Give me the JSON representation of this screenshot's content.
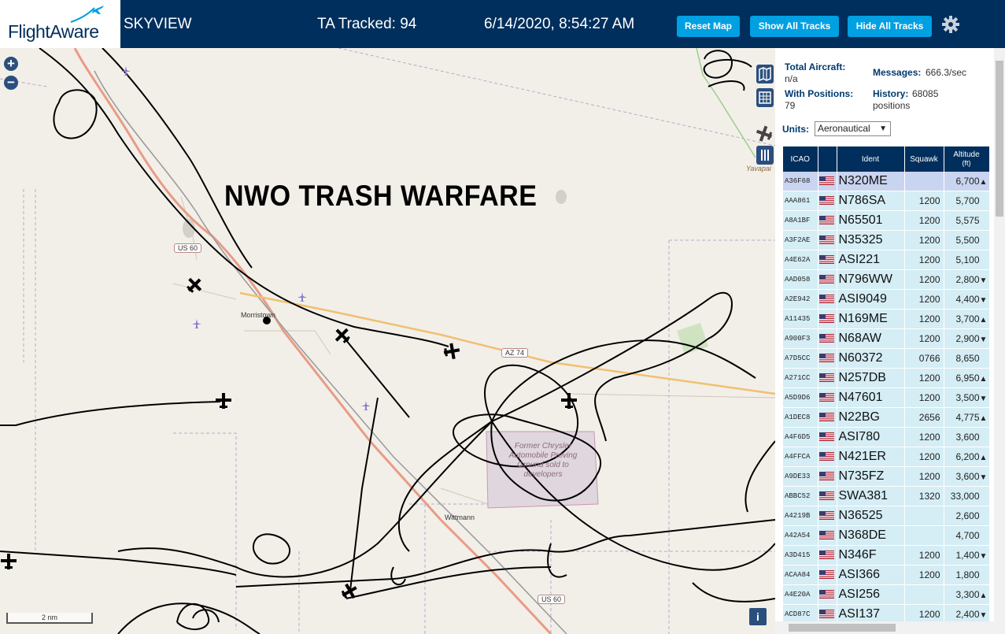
{
  "header": {
    "logo_text": "FlightAware",
    "title": "SKYVIEW",
    "tracked": "TA Tracked: 94",
    "timestamp": "6/14/2020, 8:54:27 AM",
    "buttons": {
      "reset": "Reset Map",
      "show_all": "Show All Tracks",
      "hide_all": "Hide All Tracks"
    },
    "icons": {
      "settings": "gear-icon",
      "logo": "airplane-icon"
    },
    "colors": {
      "header_bg": "#002f5d",
      "button_bg": "#00a0e2"
    }
  },
  "map": {
    "watermark": "NWO TRASH WARFARE",
    "zoom_in": "+",
    "zoom_out": "−",
    "labels": {
      "town1": "Morristown",
      "town2": "Wittmann",
      "proving_ground": "Former Chrysler Automobile Proving Ground sold to developers",
      "region": "Yavapai"
    },
    "shields": {
      "us60_top": "US 60",
      "az74": "AZ 74",
      "us60_bottom": "US 60"
    },
    "scale": "2 nm",
    "info_button": "i",
    "controls": [
      "map-icon",
      "grid-icon",
      "columns-icon"
    ]
  },
  "sidebar": {
    "stats": {
      "total_label": "Total Aircraft:",
      "total_value": "n/a",
      "positions_label": "With Positions:",
      "positions_value": "79",
      "messages_label": "Messages:",
      "messages_value": "666.3/sec",
      "history_label": "History:",
      "history_value": "68085",
      "history_unit": "positions"
    },
    "units_label": "Units:",
    "units_value": "Aeronautical",
    "table": {
      "headers": {
        "icao": "ICAO",
        "flag": "",
        "ident": "Ident",
        "squawk": "Squawk",
        "altitude": "Altitude",
        "altitude_unit": "(ft)"
      },
      "rows": [
        {
          "icao": "A36F68",
          "ident": "N320ME",
          "squawk": "",
          "alt": "6,700",
          "trend": "▲",
          "selected": true
        },
        {
          "icao": "AAA861",
          "ident": "N786SA",
          "squawk": "1200",
          "alt": "5,700",
          "trend": ""
        },
        {
          "icao": "A8A1BF",
          "ident": "N65501",
          "squawk": "1200",
          "alt": "5,575",
          "trend": ""
        },
        {
          "icao": "A3F2AE",
          "ident": "N35325",
          "squawk": "1200",
          "alt": "5,500",
          "trend": ""
        },
        {
          "icao": "A4E62A",
          "ident": "ASI221",
          "squawk": "1200",
          "alt": "5,100",
          "trend": ""
        },
        {
          "icao": "AAD058",
          "ident": "N796WW",
          "squawk": "1200",
          "alt": "2,800",
          "trend": "▼"
        },
        {
          "icao": "A2E942",
          "ident": "ASI9049",
          "squawk": "1200",
          "alt": "4,400",
          "trend": "▼"
        },
        {
          "icao": "A11435",
          "ident": "N169ME",
          "squawk": "1200",
          "alt": "3,700",
          "trend": "▲"
        },
        {
          "icao": "A900F3",
          "ident": "N68AW",
          "squawk": "1200",
          "alt": "2,900",
          "trend": "▼"
        },
        {
          "icao": "A7D5CC",
          "ident": "N60372",
          "squawk": "0766",
          "alt": "8,650",
          "trend": ""
        },
        {
          "icao": "A271CC",
          "ident": "N257DB",
          "squawk": "1200",
          "alt": "6,950",
          "trend": "▲"
        },
        {
          "icao": "A5D9D6",
          "ident": "N47601",
          "squawk": "1200",
          "alt": "3,500",
          "trend": "▼"
        },
        {
          "icao": "A1DEC8",
          "ident": "N22BG",
          "squawk": "2656",
          "alt": "4,775",
          "trend": "▲"
        },
        {
          "icao": "A4F6D5",
          "ident": "ASI780",
          "squawk": "1200",
          "alt": "3,600",
          "trend": ""
        },
        {
          "icao": "A4FFCA",
          "ident": "N421ER",
          "squawk": "1200",
          "alt": "6,200",
          "trend": "▲"
        },
        {
          "icao": "A9DE33",
          "ident": "N735FZ",
          "squawk": "1200",
          "alt": "3,600",
          "trend": "▼"
        },
        {
          "icao": "ABBC52",
          "ident": "SWA381",
          "squawk": "1320",
          "alt": "33,000",
          "trend": ""
        },
        {
          "icao": "A4219B",
          "ident": "N36525",
          "squawk": "",
          "alt": "2,600",
          "trend": ""
        },
        {
          "icao": "A42A54",
          "ident": "N368DE",
          "squawk": "",
          "alt": "4,700",
          "trend": ""
        },
        {
          "icao": "A3D415",
          "ident": "N346F",
          "squawk": "1200",
          "alt": "1,400",
          "trend": "▼"
        },
        {
          "icao": "ACAA84",
          "ident": "ASI366",
          "squawk": "1200",
          "alt": "1,800",
          "trend": ""
        },
        {
          "icao": "A4E20A",
          "ident": "ASI256",
          "squawk": "",
          "alt": "3,300",
          "trend": "▲"
        },
        {
          "icao": "ACD87C",
          "ident": "ASI137",
          "squawk": "1200",
          "alt": "2,400",
          "trend": "▼"
        }
      ]
    }
  }
}
